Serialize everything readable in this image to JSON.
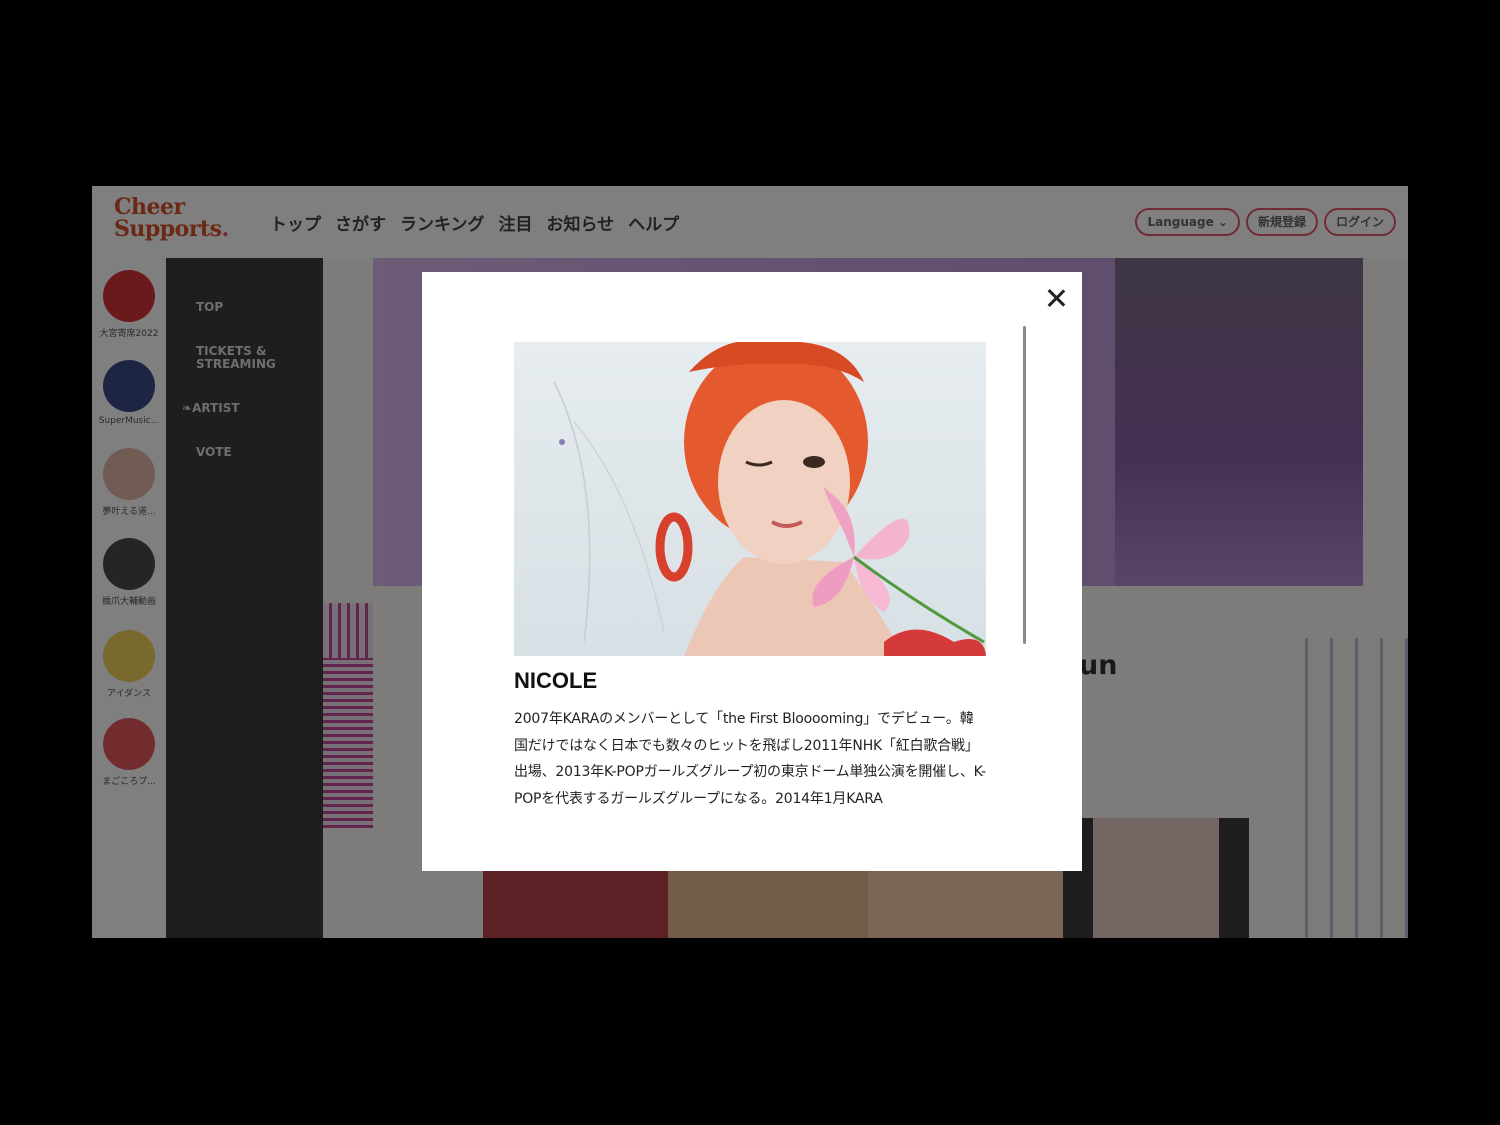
{
  "header": {
    "logo_line1": "Cheer",
    "logo_line2": "Supports",
    "nav": [
      "トップ",
      "さがす",
      "ランキング",
      "注目",
      "お知らせ",
      "ヘルプ"
    ],
    "language_label": "Language",
    "register_label": "新規登録",
    "login_label": "ログイン"
  },
  "communities": [
    {
      "label": "大宮寄席2022"
    },
    {
      "label": "SuperMusic..."
    },
    {
      "label": "夢叶える道..."
    },
    {
      "label": "橋爪大輔動画"
    },
    {
      "label": "アイダンス"
    },
    {
      "label": "まごころプ..."
    }
  ],
  "side_menu": {
    "top": "TOP",
    "tickets_line1": "TICKETS &",
    "tickets_line2": "STREAMING",
    "artist": "ARTIST",
    "vote": "VOTE"
  },
  "background": {
    "partial_name": "un"
  },
  "modal": {
    "name": "NICOLE",
    "bio": "2007年KARAのメンバーとして「the First Blooooming」でデビュー。韓国だけではなく日本でも数々のヒットを飛ばし2011年NHK「紅白歌合戦」出場、2013年K-POPガールズグループ初の東京ドーム単独公演を開催し、K-POPを代表するガールズグループになる。2014年1月KARA"
  }
}
